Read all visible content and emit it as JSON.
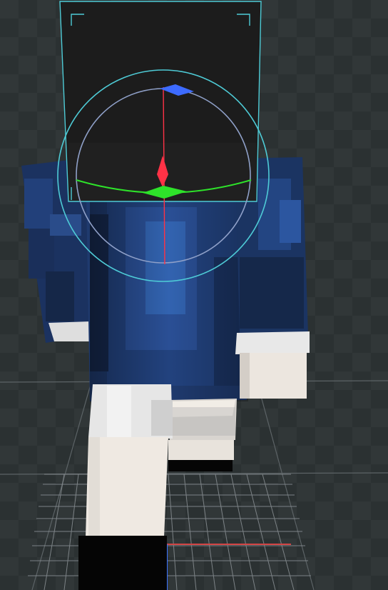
{
  "viewport": {
    "label": "",
    "background": "#2b3132"
  },
  "colors": {
    "grid_major": "#5c6366",
    "grid_minor": "#8a9094",
    "selection": "#4ecbd6",
    "gizmo_ring": "#8fa0c8",
    "axis_x": "#ff3246",
    "axis_y": "#2ee32a",
    "axis_z": "#3d6bff",
    "axis_x_ground": "#d44545",
    "axis_z_ground": "#3a72ff"
  },
  "model": {
    "head_color": "#1c1c1c",
    "shirt_color": "#1f3a6e",
    "cuff_color": "#e6e6e6",
    "hand_color": "#efe9e2",
    "boot_color": "#050505"
  },
  "gizmo": {
    "mode": "rotate",
    "axes": [
      "x",
      "y",
      "z"
    ]
  },
  "selection": {
    "target": "head"
  }
}
